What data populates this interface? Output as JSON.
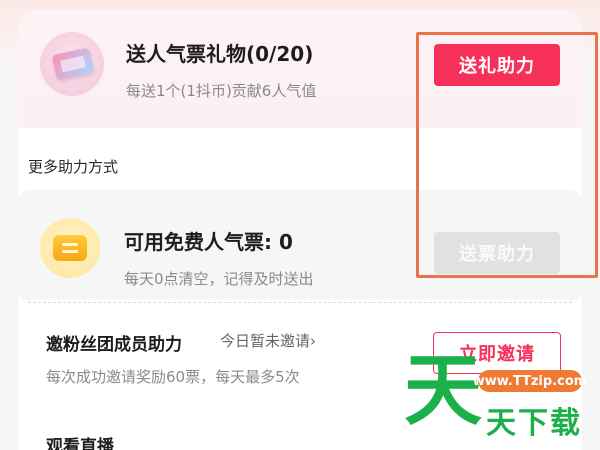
{
  "gift_card": {
    "title": "送人气票礼物(0/20)",
    "subtitle": "每送1个(1抖币)贡献6人气值",
    "button": "送礼助力"
  },
  "section_label": "更多助力方式",
  "free_tickets": {
    "title": "可用免费人气票: 0",
    "subtitle": "每天0点清空，记得及时送出",
    "button": "送票助力"
  },
  "invite": {
    "title": "邀粉丝团成员助力",
    "status": "今日暂未邀请",
    "subtitle": "每次成功邀请奖励60票，每天最多5次",
    "button": "立即邀请"
  },
  "watch": {
    "title": "观看直播"
  },
  "watermark": {
    "big_char": "天",
    "url": "www.TTzip.com",
    "text": "天下载"
  },
  "colors": {
    "accent_red": "#f7305a",
    "highlight_orange": "#e9744b",
    "watermark_green": "#1bb04a"
  },
  "icons": {
    "gift": "ticket-gift-icon",
    "free_ticket": "free-ticket-icon",
    "chevron": "chevron-right-icon"
  }
}
